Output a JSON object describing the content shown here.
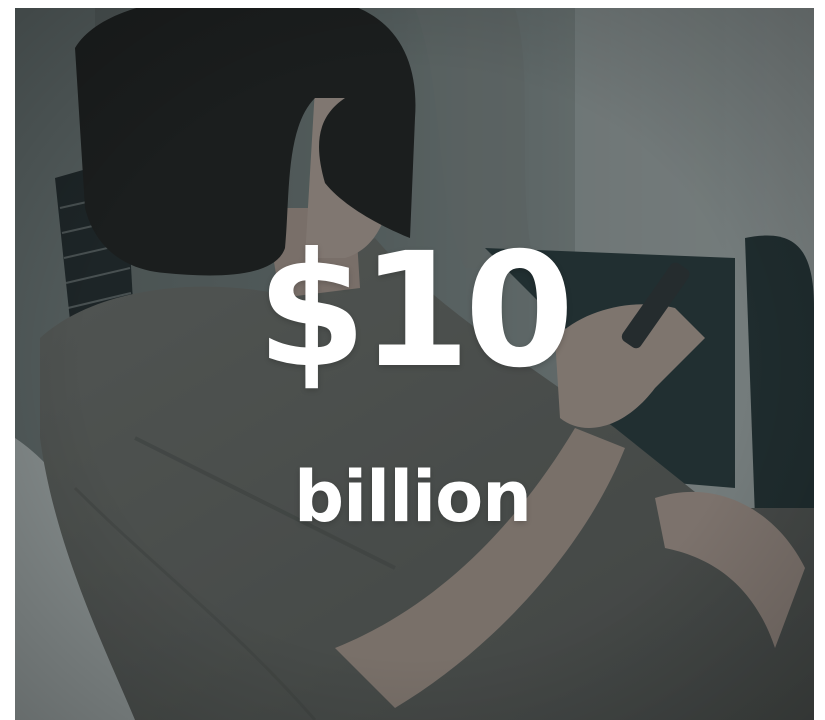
{
  "stat": {
    "amount": "$10",
    "unit": "billion"
  },
  "photo": {
    "icon": "woman-using-phone-photo",
    "colors": {
      "overlay": "#1e2a2c",
      "shirt": "#6f6d67",
      "hair": "#181513",
      "skin": "#c8aca0",
      "wall": "#8f9390",
      "text": "#ffffff"
    }
  }
}
